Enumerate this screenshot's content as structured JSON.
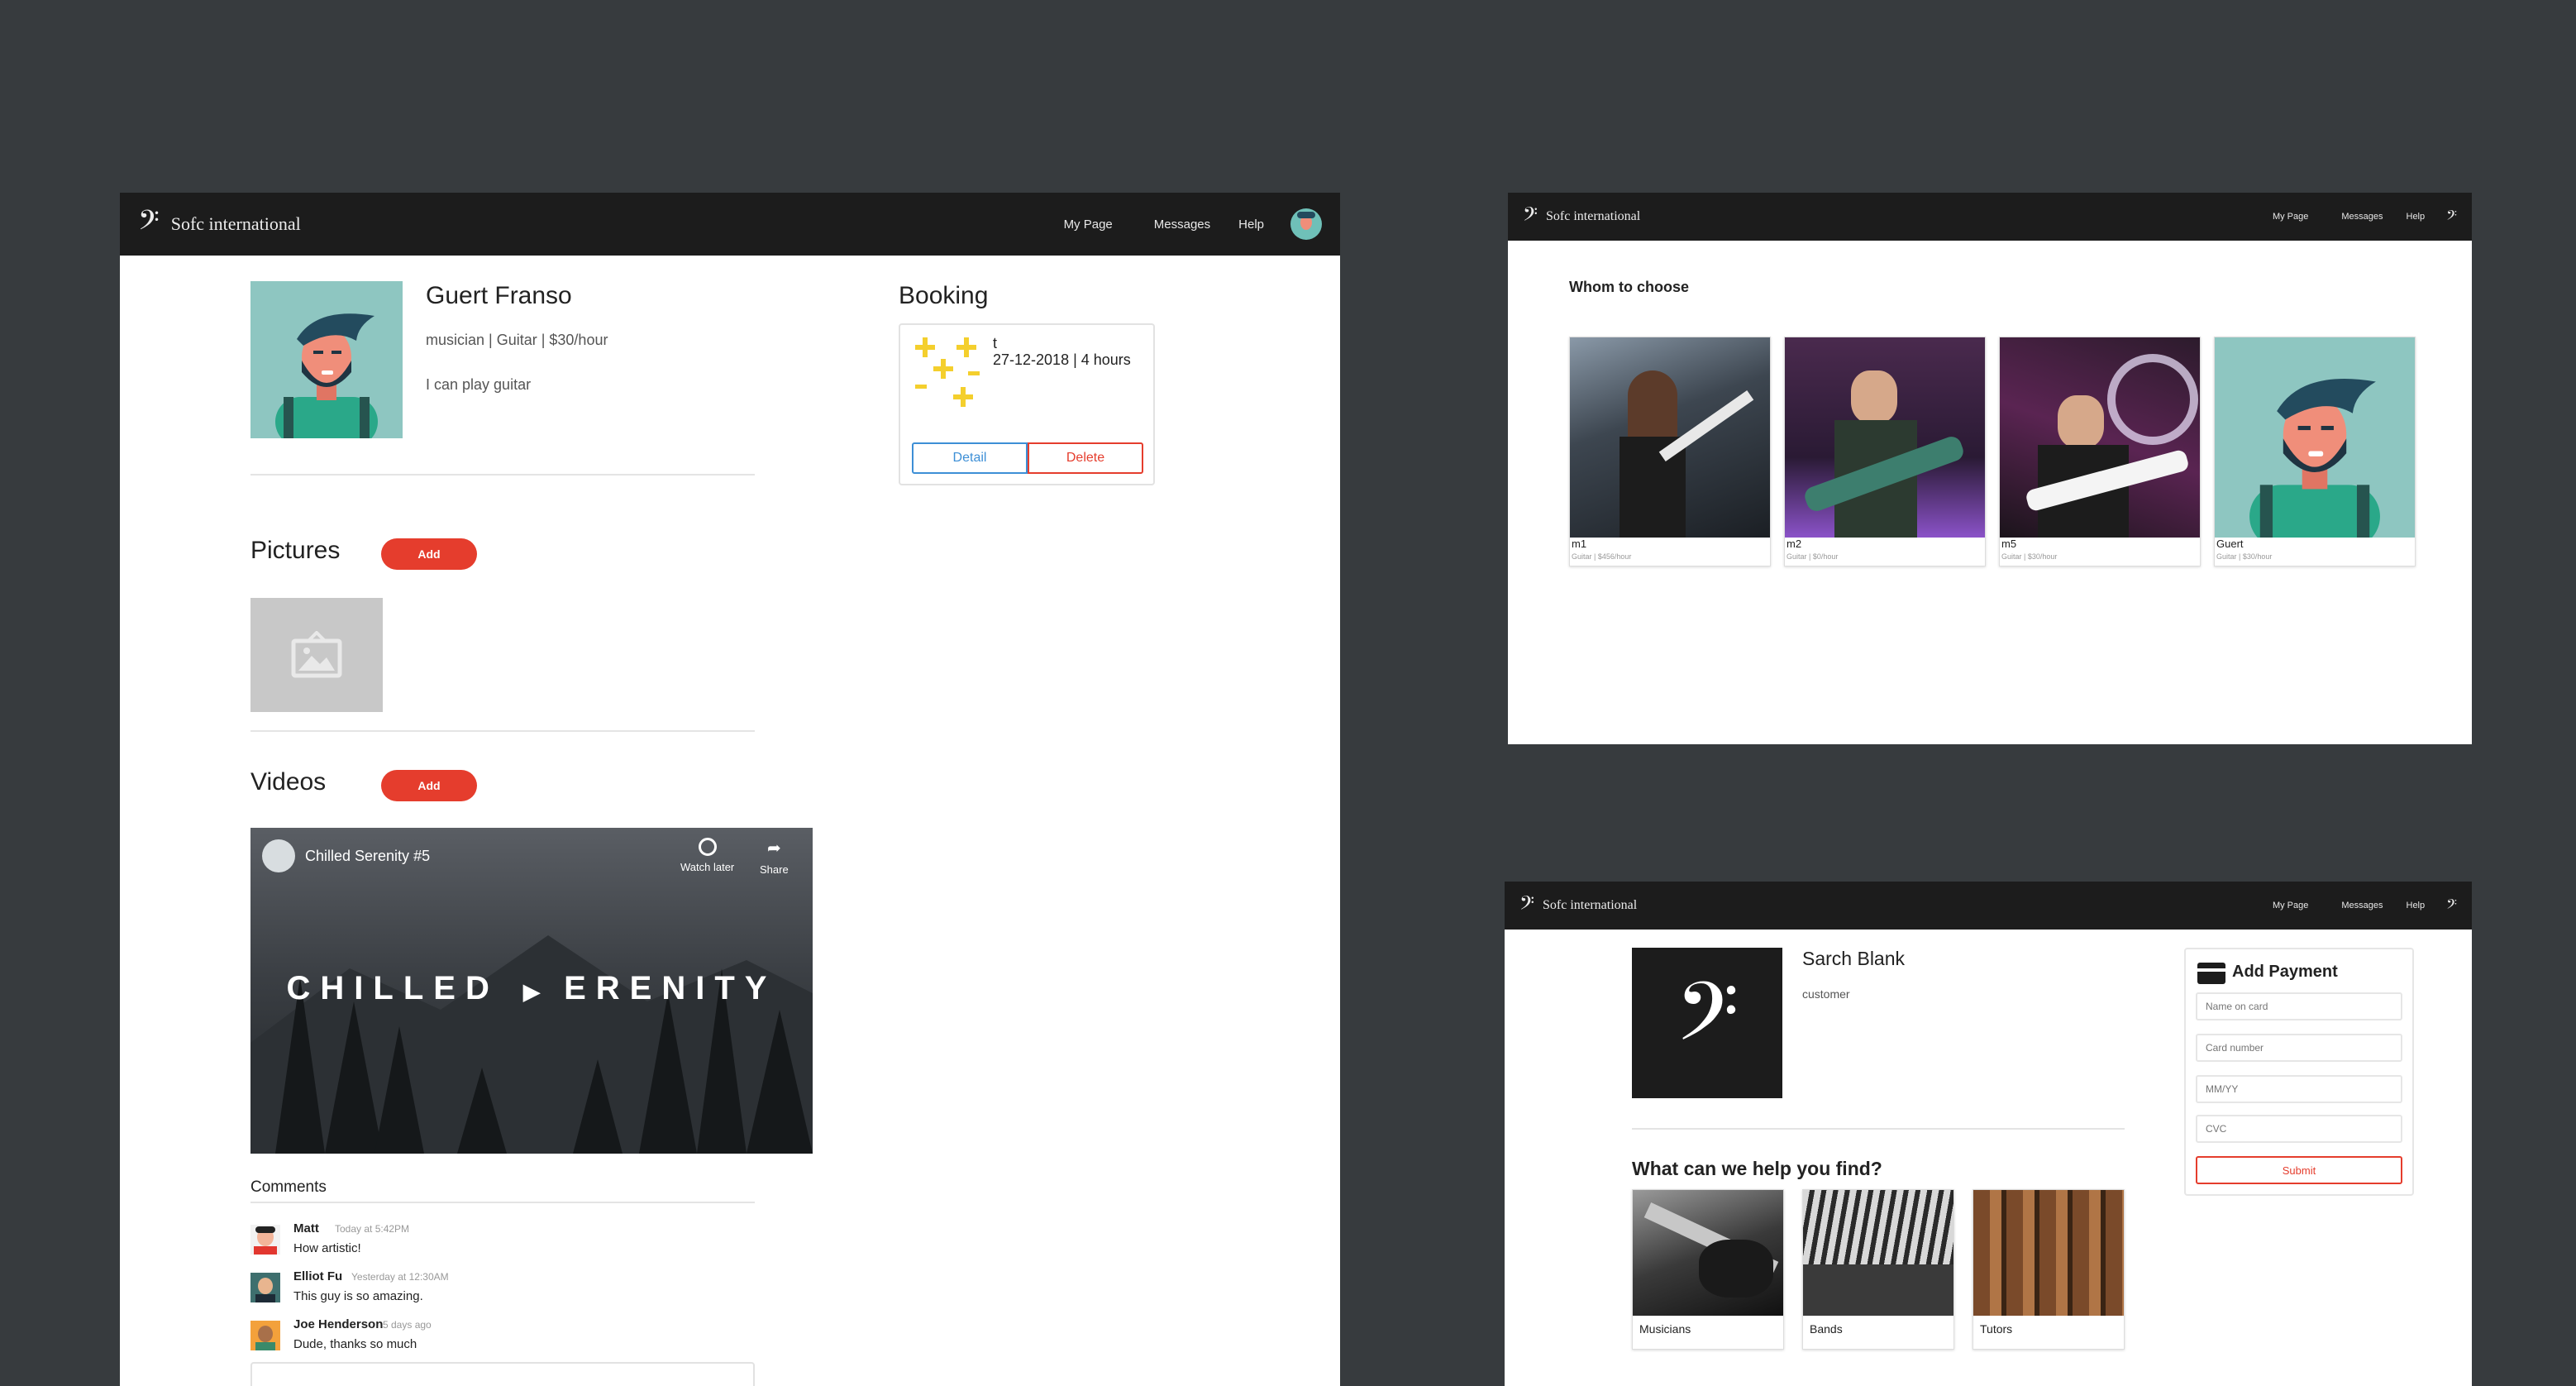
{
  "brand": {
    "name": "Sofc international"
  },
  "nav": {
    "my_page": "My Page",
    "messages": "Messages",
    "help": "Help"
  },
  "profile": {
    "name": "Guert Franso",
    "meta": "musician | Guitar | $30/hour",
    "bio": "I can play guitar"
  },
  "booking": {
    "title": "Booking",
    "name": "t",
    "when": "27-12-2018 | 4 hours",
    "detail": "Detail",
    "delete": "Delete"
  },
  "pictures": {
    "title": "Pictures",
    "add": "Add"
  },
  "videos": {
    "title": "Videos",
    "add": "Add",
    "video_title": "Chilled Serenity #5",
    "watch_later": "Watch later",
    "share": "Share",
    "overlay_left": "CHILLED",
    "overlay_right": "ERENITY"
  },
  "comments": {
    "title": "Comments",
    "items": [
      {
        "author": "Matt",
        "time": "Today at 5:42PM",
        "text": "How artistic!"
      },
      {
        "author": "Elliot Fu",
        "time": "Yesterday at 12:30AM",
        "text": "This guy is so amazing."
      },
      {
        "author": "Joe Henderson",
        "time": "5 days ago",
        "text": "Dude, thanks so much"
      }
    ]
  },
  "choose": {
    "title": "Whom to choose",
    "cards": [
      {
        "name": "m1",
        "meta": "Guitar | $456/hour"
      },
      {
        "name": "m2",
        "meta": "Guitar | $0/hour"
      },
      {
        "name": "m5",
        "meta": "Guitar | $30/hour"
      },
      {
        "name": "Guert",
        "meta": "Guitar | $30/hour"
      }
    ]
  },
  "customer": {
    "name": "Sarch Blank",
    "role": "customer",
    "help_title": "What can we help you find?",
    "categories": [
      "Musicians",
      "Bands",
      "Tutors"
    ]
  },
  "payment": {
    "title": "Add Payment",
    "name_placeholder": "Name on card",
    "card_placeholder": "Card number",
    "exp_placeholder": "MM/YY",
    "cvc_placeholder": "CVC",
    "submit": "Submit"
  },
  "colors": {
    "accent_red": "#e53d2d",
    "nav_bg": "#1c1c1c",
    "page_bg": "#373b3e",
    "link_blue": "#3d8fd6"
  }
}
